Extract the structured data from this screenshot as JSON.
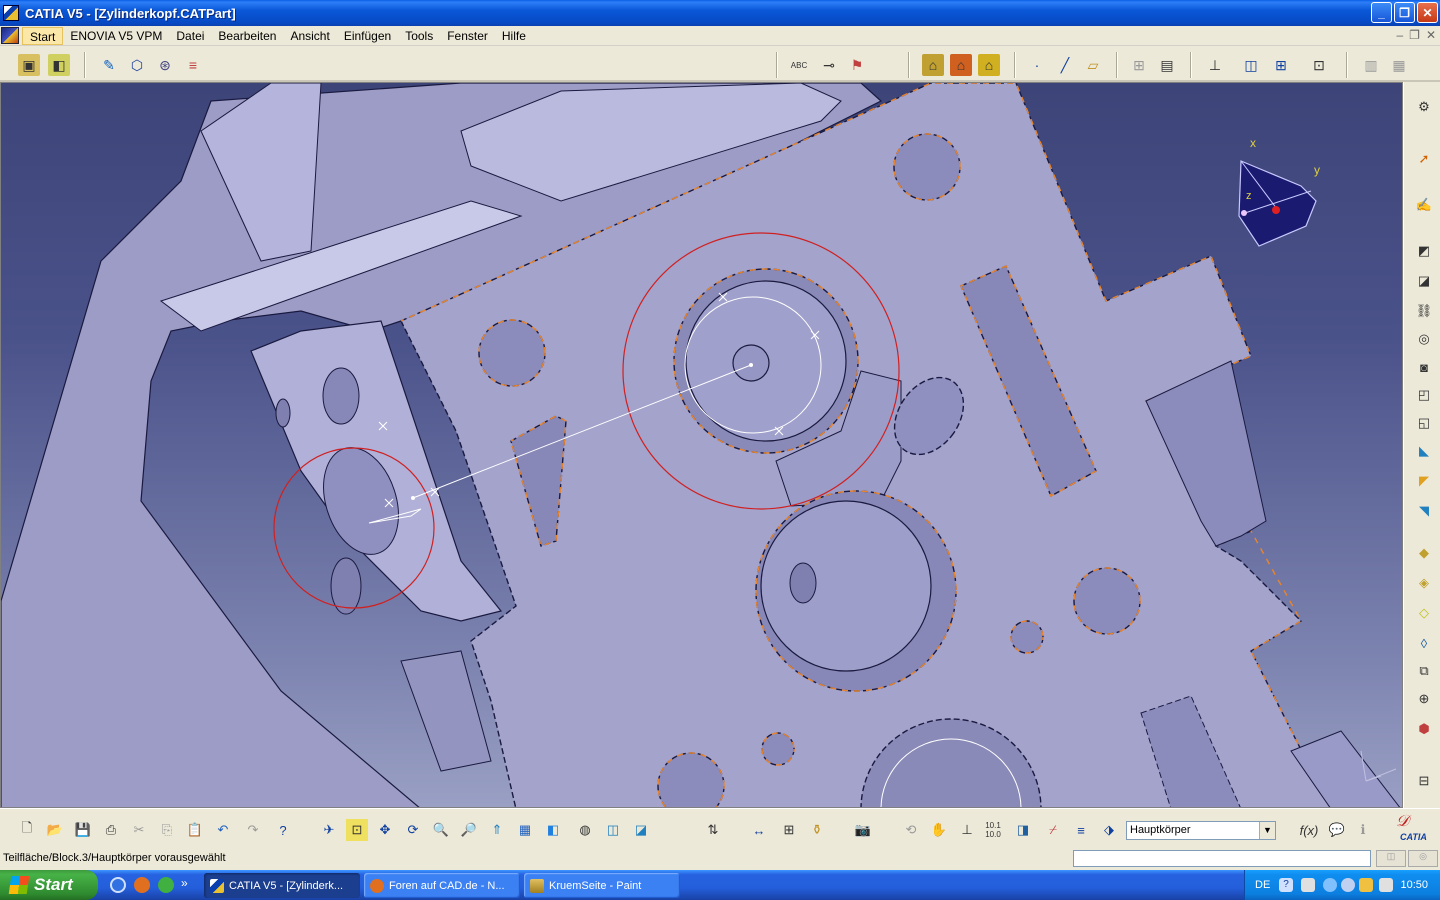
{
  "window": {
    "title": "CATIA V5 - [Zylinderkopf.CATPart]"
  },
  "menu": {
    "items": [
      "Start",
      "ENOVIA V5 VPM",
      "Datei",
      "Bearbeiten",
      "Ansicht",
      "Einfügen",
      "Tools",
      "Fenster",
      "Hilfe"
    ]
  },
  "compass": {
    "x": "x",
    "y": "y",
    "z": "z"
  },
  "body_select": {
    "value": "Hauptkörper"
  },
  "status": {
    "text": "Teilfläche/Block.3/Hauptkörper vorausgewählt"
  },
  "brand": {
    "logo_text": "CATIA"
  },
  "toolbar_texts": {
    "abc": "ABC",
    "ratio_top": "10.1",
    "ratio_bottom": "10.0"
  },
  "taskbar": {
    "start_label": "Start",
    "tasks": [
      {
        "label": "CATIA V5 - [Zylinderk...",
        "active": true
      },
      {
        "label": "Foren auf CAD.de - N...",
        "active": false
      },
      {
        "label": "KruemSeite - Paint",
        "active": false
      }
    ],
    "language": "DE",
    "clock": "10:50"
  },
  "colors": {
    "titlebar": "#0a58d8",
    "background_top": "#3c4478",
    "background_bottom": "#9aa0c4",
    "part_fill": "#a9a9cf",
    "edge_highlight": "#e8842c",
    "measure_circle": "#d02020",
    "taskbar": "#245edb",
    "start_button": "#2f8a2f"
  }
}
